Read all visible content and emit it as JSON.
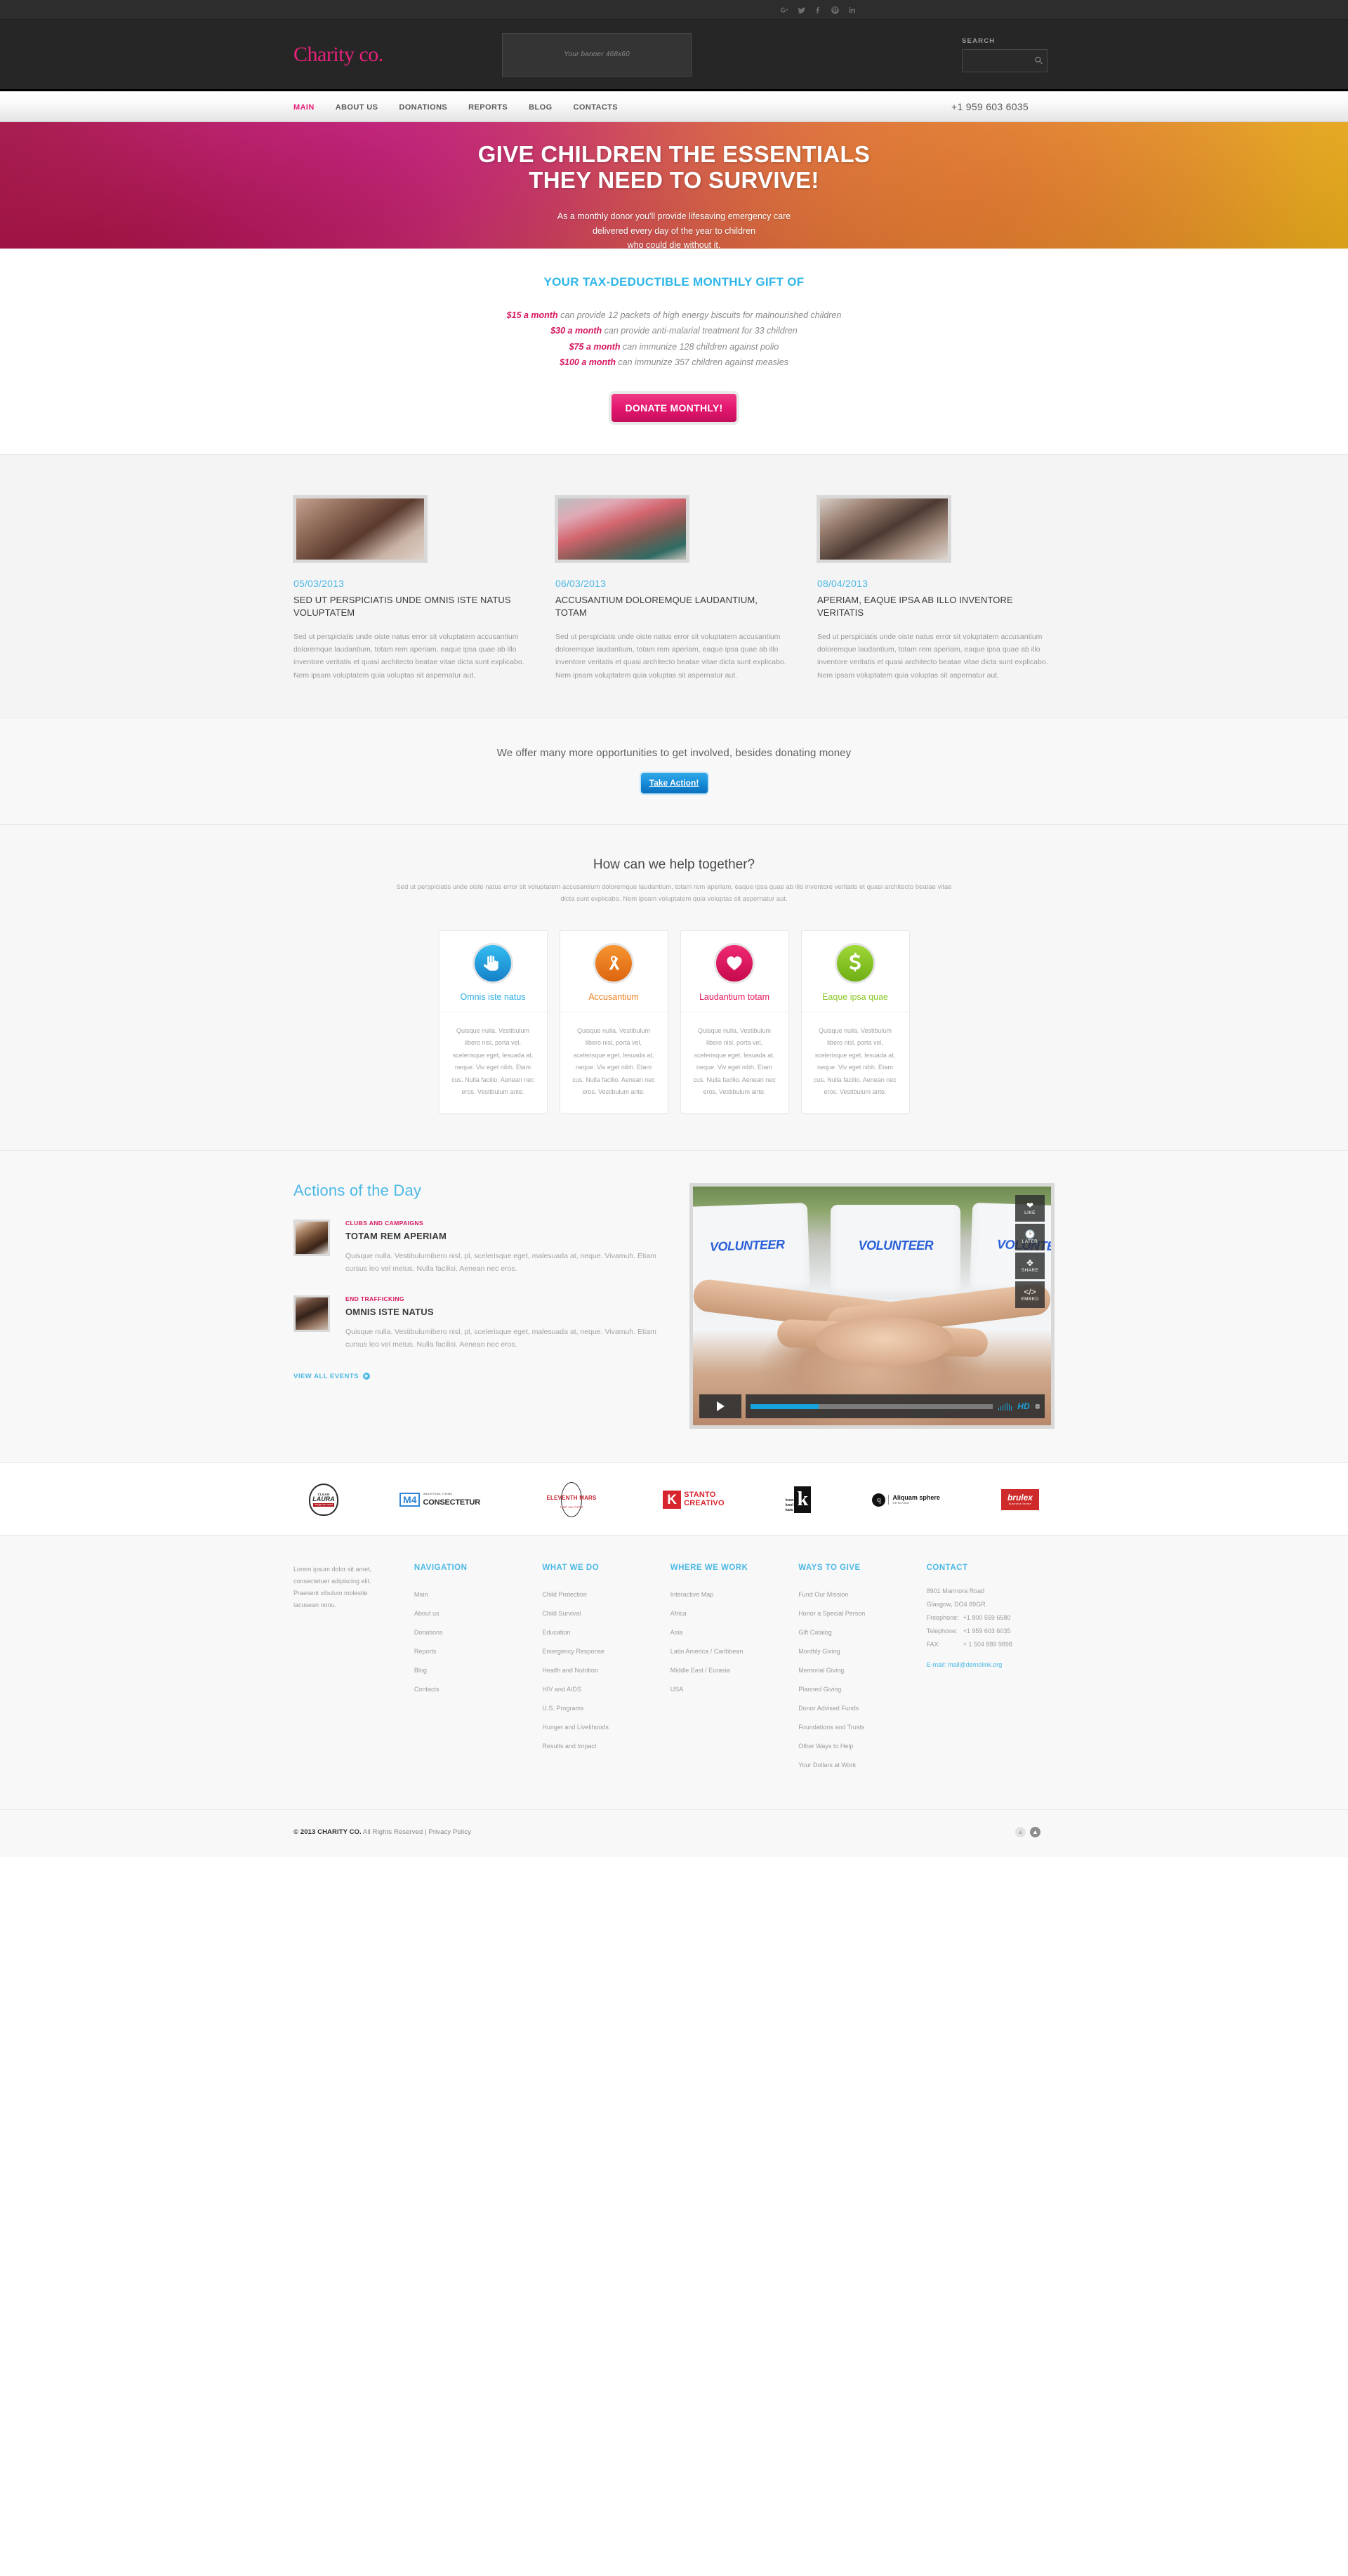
{
  "topbar": {
    "social": [
      {
        "name": "google-plus",
        "label": "g+"
      },
      {
        "name": "twitter",
        "label": "t"
      },
      {
        "name": "facebook",
        "label": "f"
      },
      {
        "name": "pinterest",
        "label": "p"
      },
      {
        "name": "linkedin",
        "label": "in"
      }
    ]
  },
  "header": {
    "logo": "Charity co.",
    "banner_placeholder": "Your banner 468x60",
    "search_label": "SEARCH",
    "search_value": "",
    "search_placeholder": ""
  },
  "nav": {
    "items": [
      {
        "label": "MAIN",
        "active": true
      },
      {
        "label": "ABOUT US",
        "active": false
      },
      {
        "label": "DONATIONS",
        "active": false
      },
      {
        "label": "REPORTS",
        "active": false
      },
      {
        "label": "BLOG",
        "active": false
      },
      {
        "label": "CONTACTS",
        "active": false
      }
    ],
    "phone": "+1 959 603 6035"
  },
  "hero": {
    "title_line1": "GIVE CHILDREN THE ESSENTIALS",
    "title_line2": "THEY NEED TO SURVIVE!",
    "sub_line1": "As a monthly donor you'll provide lifesaving emergency care",
    "sub_line2": "delivered every day of the year to children",
    "sub_line3": "who could die without it."
  },
  "gift": {
    "heading": "YOUR TAX-DEDUCTIBLE MONTHLY GIFT OF",
    "lines": [
      {
        "amount": "$15 a month",
        "text": " can provide 12 packets of high energy biscuits for malnourished children"
      },
      {
        "amount": "$30 a month",
        "text": " can provide anti-malarial treatment for 33 children"
      },
      {
        "amount": "$75 a month",
        "text": " can immunize 128 children against polio"
      },
      {
        "amount": "$100 a month",
        "text": " can immunize 357 children against measles"
      }
    ],
    "donate_label": "DONATE MONTHLY!"
  },
  "news": [
    {
      "date": "05/03/2013",
      "title": "SED UT PERSPICIATIS UNDE OMNIS ISTE NATUS VOLUPTATEM",
      "text": "Sed ut perspiciatis unde oiste natus error sit voluptatem accusantium doloremque laudantium, totam rem aperiam, eaque ipsa quae ab illo inventore veritatis et quasi architecto beatae vitae dicta sunt explicabo. Nem ipsam voluptatem quia voluptas sit aspernatur aut."
    },
    {
      "date": "06/03/2013",
      "title": "ACCUSANTIUM DOLOREMQUE LAUDANTIUM, TOTAM",
      "text": "Sed ut perspiciatis unde oiste natus error sit voluptatem accusantium doloremque laudantium, totam rem aperiam, eaque ipsa quae ab illo inventore veritatis et quasi architecto beatae vitae dicta sunt explicabo. Nem ipsam voluptatem quia voluptas sit aspernatur aut."
    },
    {
      "date": "08/04/2013",
      "title": "APERIAM, EAQUE IPSA AB ILLO INVENTORE VERITATIS",
      "text": "Sed ut perspiciatis unde oiste natus error sit voluptatem accusantium doloremque laudantium, totam rem aperiam, eaque ipsa quae ab illo inventore veritatis et quasi architecto beatae vitae dicta sunt explicabo. Nem ipsam voluptatem quia voluptas sit aspernatur aut."
    }
  ],
  "cta": {
    "text": "We offer many more opportunities to get involved, besides donating money",
    "button_label": "Take Action!"
  },
  "help": {
    "heading": "How can we help together?",
    "sub": "Sed ut perspiciatis unde oiste natus error sit voluptatem accusantium doloremque laudantium, totam rem aperiam, eaque ipsa quae ab illo inventore veritatis et quasi architecto beatae vitae dicta sunt explicabo. Nem ipsam voluptatem quia voluptas sit aspernatur aut.",
    "services": [
      {
        "icon": "helping-hand-icon",
        "name": "Omnis iste natus",
        "color": "#29ABE2",
        "text": "Quisque nulla. Vestibulum libero nisl, porta vel, scelerisque eget, lesuada at, neque. Viv eget nibh. Etam cus. Nulla facilio. Aenean nec eros. Vestibulum ante."
      },
      {
        "icon": "awareness-ribbon-icon",
        "name": "Accusantium",
        "color": "#F08020",
        "text": "Quisque nulla. Vestibulum libero nisl, porta vel, scelerisque eget, lesuada at, neque. Viv eget nibh. Etam cus. Nulla facilio. Aenean nec eros. Vestibulum ante."
      },
      {
        "icon": "heart-icon",
        "name": "Laudantium totam",
        "color": "#E6175C",
        "text": "Quisque nulla. Vestibulum libero nisl, porta vel, scelerisque eget, lesuada at, neque. Viv eget nibh. Etam cus. Nulla facilio. Aenean nec eros. Vestibulum ante."
      },
      {
        "icon": "dollar-sign-icon",
        "name": "Eaque ipsa quae",
        "color": "#8BC727",
        "text": "Quisque nulla. Vestibulum libero nisl, porta vel, scelerisque eget, lesuada at, neque. Viv eget nibh. Etam cus. Nulla facilio. Aenean nec eros. Vestibulum ante."
      }
    ]
  },
  "actions": {
    "heading": "Actions of the Day",
    "items": [
      {
        "category": "CLUBS AND CAMPAIGNS",
        "title": "TOTAM REM APERIAM",
        "text": "Quisque nulla. Vestibulumibero nisl, pl, scelerisque eget, malesuada at, neque. Vivamuh. Etiam cursus leo vel metus. Nulla facilisi. Aenean nec eros."
      },
      {
        "category": "END TRAFFICKING",
        "title": "OMNIS ISTE NATUS",
        "text": "Quisque nulla. Vestibulumibero nisl, pl, scelerisque eget, malesuada at, neque. Vivamuh. Etiam cursus leo vel metus. Nulla facilisi. Aenean nec eros."
      }
    ],
    "view_all_label": "VIEW ALL EVENTS",
    "video": {
      "shirt_text": "VOLUNTEER",
      "buttons": [
        {
          "icon": "heart-icon",
          "label": "LIKE"
        },
        {
          "icon": "clock-icon",
          "label": "LATER"
        },
        {
          "icon": "share-icon",
          "label": "SHARE"
        },
        {
          "icon": "code-icon",
          "label": "EMBED"
        }
      ],
      "quality_label": "HD",
      "progress_percent": 28
    }
  },
  "partners": [
    {
      "name": "clean-laura",
      "top": "CLEAN",
      "main": "LAURA",
      "sub": "design you need"
    },
    {
      "name": "m4-consectetur",
      "badge": "M4",
      "tiny": "INDUSTRIAL THEME",
      "main": "CONSECTETUR"
    },
    {
      "name": "eleventh-mars",
      "main": "ELEVENTH MARS",
      "sub": "TIME MATTERS"
    },
    {
      "name": "kstanto-creativo",
      "badge": "K",
      "line1": "STANTO",
      "line2": "CREATIVO"
    },
    {
      "name": "kreo-kool-kats",
      "w1": "kreo",
      "w2": "kool",
      "w3": "kats",
      "badge": "k"
    },
    {
      "name": "aliquam-sphere",
      "badge": "q",
      "main": "Aliquam sphere",
      "sub": "CHICAGO"
    },
    {
      "name": "brulex",
      "main": "brulex",
      "sub": "business theme"
    }
  ],
  "footer": {
    "about": "Lorem ipsum dolor sit amet, consectetuer adipiscing elit. Praesent vibulum molestie lacusean nonu.",
    "columns": [
      {
        "title": "NAVIGATION",
        "links": [
          "Main",
          "About us",
          "Donations",
          "Reports",
          "Blog",
          "Contacts"
        ]
      },
      {
        "title": "WHAT WE DO",
        "links": [
          "Child Protection",
          "Child Survival",
          "Education",
          "Emergency Response",
          "Health and Nutrition",
          "HIV and AIDS",
          "U.S. Programs",
          "Hunger and Livelihoods",
          "Results and Impact"
        ]
      },
      {
        "title": "WHERE WE WORK",
        "links": [
          "Interactive Map",
          "Africa",
          "Asia",
          "Latin America / Caribbean",
          "Middle East / Eurasia",
          "USA"
        ]
      },
      {
        "title": "WAYS TO GIVE",
        "links": [
          "Fund Our Mission",
          "Honor a Special Person",
          "Gift Catalog",
          "Monthly Giving",
          "Memorial Giving",
          "Planned Giving",
          "Donor Advised Funds",
          "Foundations and Trusts",
          "Other Ways to Help",
          "Your Dollars at Work"
        ]
      }
    ],
    "contact": {
      "title": "CONTACT",
      "address_line1": "8901 Marmora Road",
      "address_line2": "Glasgow, DO4 89GR.",
      "freephone_label": "Freephone:",
      "freephone": "+1 800 559 6580",
      "telephone_label": "Telephone:",
      "telephone": "+1 959 603 6035",
      "fax_label": "FAX:",
      "fax": "+ 1 504 889 9898",
      "email_label": "E-mail: mail@demolink.org"
    }
  },
  "copyright": {
    "brand": "© 2013 CHARITY CO.",
    "rights": " All Rights Reserved | ",
    "privacy": "Privacy Policy"
  },
  "colors": {
    "accent_pink": "#e6217a",
    "accent_blue": "#4cb8e6",
    "dark": "#262626"
  }
}
